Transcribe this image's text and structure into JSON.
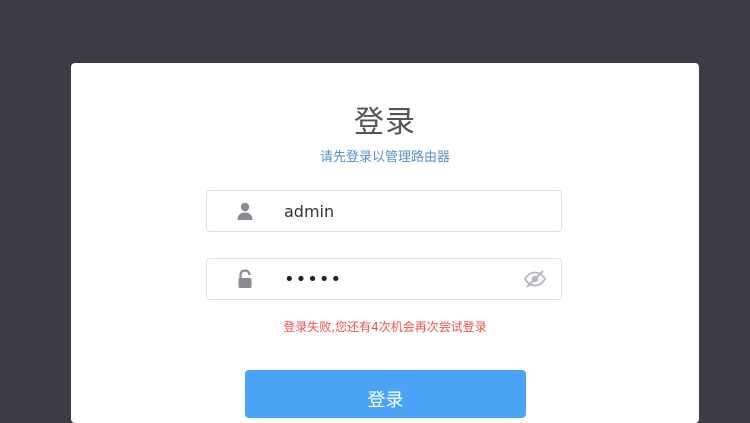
{
  "login": {
    "title": "登录",
    "subtitle": "请先登录以管理路由器",
    "username": {
      "value": "admin",
      "icon": "user-icon"
    },
    "password": {
      "value": "•••••",
      "icon": "lock-icon",
      "toggle_icon": "eye-off-icon"
    },
    "error_message": "登录失败,您还有4次机会再次尝试登录",
    "submit_label": "登录"
  },
  "colors": {
    "background": "#3b3c45",
    "card": "#ffffff",
    "accent": "#4aa3f7",
    "error": "#f0524f",
    "subtitle": "#5b8fc4"
  }
}
